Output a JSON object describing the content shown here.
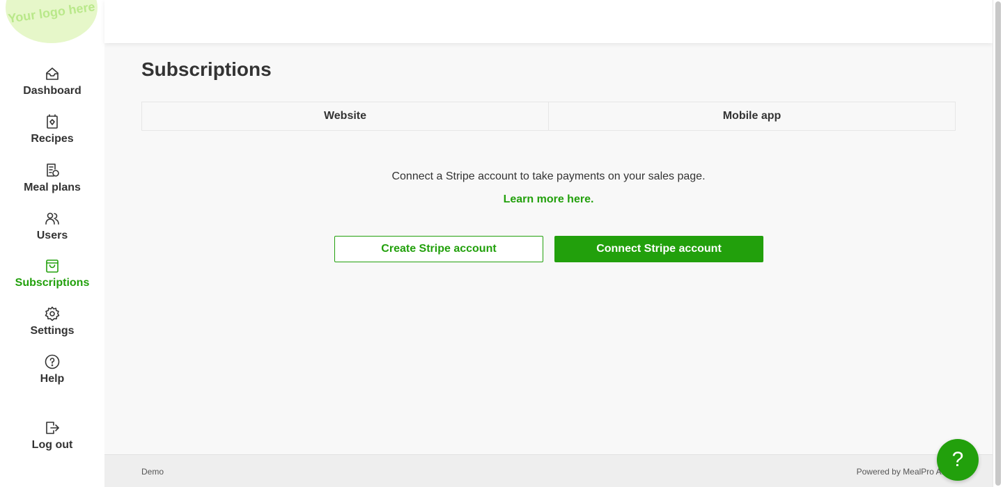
{
  "brand": {
    "logo_text": "Your logo here",
    "accent": "#22a00c"
  },
  "sidebar": {
    "items": [
      {
        "label": "Dashboard",
        "icon": "inbox-icon"
      },
      {
        "label": "Recipes",
        "icon": "recipe-book-icon"
      },
      {
        "label": "Meal plans",
        "icon": "meal-plan-icon"
      },
      {
        "label": "Users",
        "icon": "users-icon"
      },
      {
        "label": "Subscriptions",
        "icon": "shopping-bag-icon",
        "active": true
      },
      {
        "label": "Settings",
        "icon": "gear-icon"
      },
      {
        "label": "Help",
        "icon": "help-circle-icon"
      },
      {
        "label": "Log out",
        "icon": "logout-icon"
      }
    ]
  },
  "main": {
    "title": "Subscriptions",
    "tabs": [
      {
        "label": "Website"
      },
      {
        "label": "Mobile app"
      }
    ],
    "message": "Connect a Stripe account to take payments on your sales page.",
    "learn_more": "Learn more here.",
    "buttons": {
      "create": "Create Stripe account",
      "connect": "Connect Stripe account"
    }
  },
  "footer": {
    "left": "Demo",
    "right": "Powered by MealPro AI"
  },
  "help_button": {
    "label": "?"
  }
}
